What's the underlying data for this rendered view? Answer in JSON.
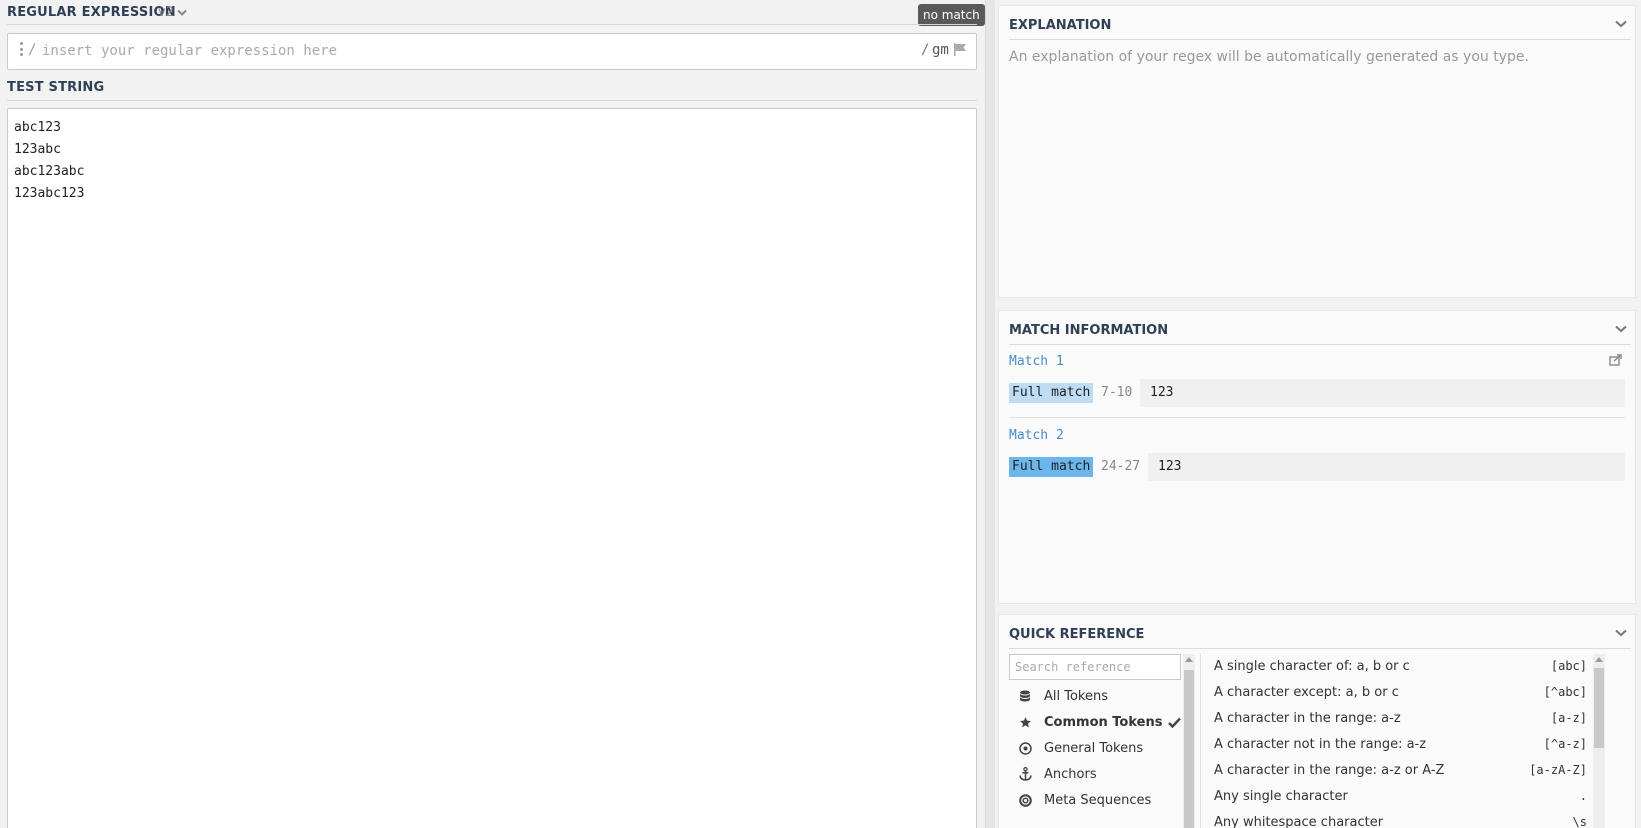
{
  "regex": {
    "title": "REGULAR EXPRESSION",
    "version": "v2",
    "status": "no match",
    "open_delim": "/",
    "placeholder": "insert your regular expression here",
    "value": "",
    "close_delim": "/",
    "flags": "gm"
  },
  "test": {
    "title": "TEST STRING",
    "lines": [
      "abc123",
      "123abc",
      "abc123abc",
      "123abc123"
    ]
  },
  "explanation": {
    "title": "EXPLANATION",
    "text": "An explanation of your regex will be automatically generated as you type."
  },
  "match_info": {
    "title": "MATCH INFORMATION",
    "matches": [
      {
        "label": "Match 1",
        "tag": "Full match",
        "range": "7-10",
        "value": "123",
        "tag_color": "#bfdcf5"
      },
      {
        "label": "Match 2",
        "tag": "Full match",
        "range": "24-27",
        "value": "123",
        "tag_color": "#6bb6ea"
      }
    ]
  },
  "quick_ref": {
    "title": "QUICK REFERENCE",
    "search_placeholder": "Search reference",
    "categories": [
      {
        "label": "All Tokens",
        "icon": "database-icon",
        "active": false
      },
      {
        "label": "Common Tokens",
        "icon": "star-icon",
        "active": true
      },
      {
        "label": "General Tokens",
        "icon": "target-icon",
        "active": false
      },
      {
        "label": "Anchors",
        "icon": "anchor-icon",
        "active": false
      },
      {
        "label": "Meta Sequences",
        "icon": "lifebuoy-icon",
        "active": false
      }
    ],
    "items": [
      {
        "desc": "A single character of: a, b or c",
        "token": "[abc]"
      },
      {
        "desc": "A character except: a, b or c",
        "token": "[^abc]"
      },
      {
        "desc": "A character in the range: a-z",
        "token": "[a-z]"
      },
      {
        "desc": "A character not in the range: a-z",
        "token": "[^a-z]"
      },
      {
        "desc": "A character in the range: a-z or A-Z",
        "token": "[a-zA-Z]"
      },
      {
        "desc": "Any single character",
        "token": "."
      },
      {
        "desc": "Any whitespace character",
        "token": "\\s"
      }
    ]
  },
  "colors": {
    "accent": "#2f4056",
    "match_link": "#4a8cc9",
    "badge_bg": "#595959"
  }
}
